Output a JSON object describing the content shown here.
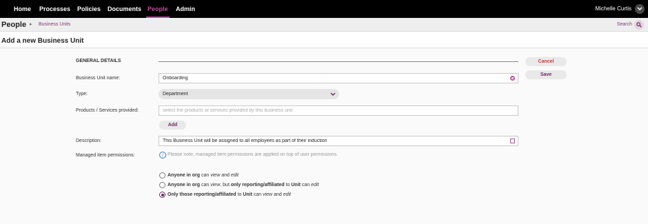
{
  "nav": {
    "items": [
      "Home",
      "Processes",
      "Policies",
      "Documents",
      "People",
      "Admin"
    ],
    "active": "People",
    "user": "Michelle Curtis"
  },
  "subheader": {
    "title": "People",
    "breadcrumb": "Business Units",
    "search_label": "Search"
  },
  "page": {
    "title": "Add a new Business Unit"
  },
  "actions": {
    "cancel": "Cancel",
    "save": "Save"
  },
  "form": {
    "section_title": "GENERAL DETAILS",
    "name_label": "Business Unit name:",
    "name_value": "Onboarding",
    "type_label": "Type:",
    "type_value": "Department",
    "products_label": "Products / Services provided:",
    "products_placeholder": "select the products or services provided by this business unit",
    "add_label": "Add",
    "description_label": "Description:",
    "description_value": "This Business Unit will be assigned to all employees as part of their induction",
    "permissions_label": "Managed item permissions:",
    "permissions_note": "Please note, managed item permissions are applied on top of user permissions.",
    "radio_options": [
      {
        "b1": "Anyone in org",
        "t1": " can ",
        "i1": "view",
        "t2": " and ",
        "i2": "edit",
        "checked": false
      },
      {
        "b1": "Anyone in org",
        "t1": " can ",
        "i1": "view",
        "t2": ", but ",
        "b2": "only reporting/affiliated",
        "t3": " to ",
        "b3": "Unit",
        "t4": " can ",
        "i2": "edit",
        "checked": false
      },
      {
        "b1": "Only those reporting/affiliated",
        "t1": " to ",
        "b2": "Unit",
        "t2": " can ",
        "i1": "view",
        "t3": " and ",
        "i2": "edit",
        "checked": true
      }
    ]
  },
  "colors": {
    "accent": "#c04a9e",
    "topbar": "#000000",
    "cancel": "#d03a3a"
  }
}
